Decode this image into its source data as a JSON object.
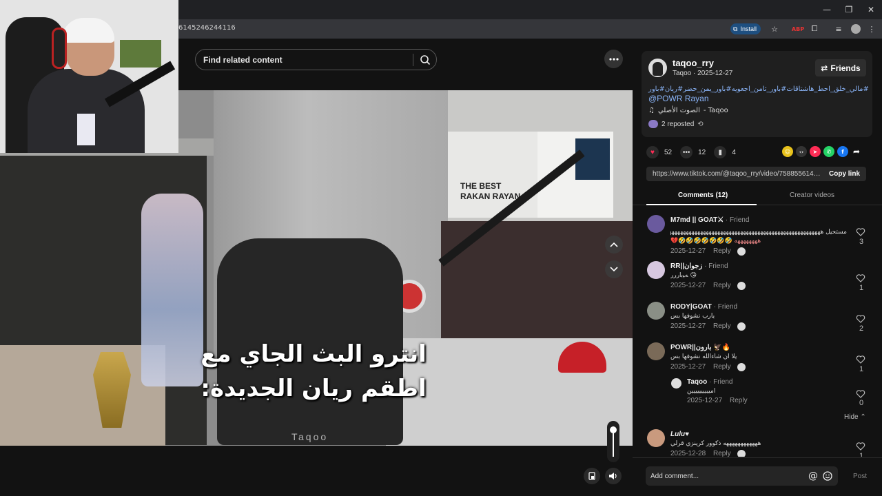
{
  "browser": {
    "url": "6145246244116",
    "install_label": "Install"
  },
  "video": {
    "search_placeholder": "Find related content",
    "caption_line1": "انترو البث الجاي مع",
    "caption_line2": "اطقم ريان الجديدة:",
    "watermark": "Taqoo",
    "poster_text": "THE BEST RAKAN RAYAN",
    "volume_level": 0.9
  },
  "post": {
    "username": "taqoo_rry",
    "meta": "Taqoo · 2025-12-27",
    "friends_label": "Friends",
    "hashtags": "#مالي_خلق_احط_هاشتاقات#باور_ثامن_اجعويه#باور_يمن_حضر#ريان#باور",
    "mention": "@POWR Rayan",
    "sound_name": "الصوت الأصلي",
    "sound_author": "- Taqoo",
    "reposted": "2 reposted",
    "likes": "52",
    "comments": "12",
    "saves": "4",
    "link": "https://www.tiktok.com/@taqoo_rry/video/7588556145...",
    "copy_link_label": "Copy link"
  },
  "tabs": {
    "comments_label": "Comments (12)",
    "creator_label": "Creator videos"
  },
  "comments": [
    {
      "name": "M7md || GOAT⚔",
      "friend": " · Friend",
      "text": "مستحيل ههههههههههههههههههههههههههههههههههههههههههههههههههههههههههه",
      "emoji": "💔🤣🤣🤣🤣🤣🤣🤣 ههههههههه",
      "date": "2025-12-27",
      "reply": "Reply",
      "likes": "3"
    },
    {
      "name": "RR||زجوان",
      "friend": " · Friend",
      "text": "ﻪﻴﺑاﺭﺭﺭ 😘",
      "date": "2025-12-27",
      "reply": "Reply",
      "likes": "1"
    },
    {
      "name": "RODY|GOAT",
      "friend": " · Friend",
      "text": "يارب نشوفها بس",
      "date": "2025-12-27",
      "reply": "Reply",
      "likes": "2"
    },
    {
      "name": "POWR||بارون 🦅🔥",
      "friend": "",
      "text": "يلا ان شاءالله نشوفها بس",
      "date": "2025-12-27",
      "reply": "Reply",
      "likes": "1"
    },
    {
      "name": "Taqoo",
      "friend": " · Friend",
      "text": "اميييييييييين",
      "date": "2025-12-27",
      "reply": "Reply",
      "likes": "0"
    },
    {
      "name": "Lulu♥",
      "friend": "",
      "text": "ههههههههههههه ذكوور كرينزي قرلي",
      "date": "2025-12-28",
      "reply": "Reply",
      "likes": "1"
    }
  ],
  "hide_label": "Hide",
  "comment_box": {
    "placeholder": "Add comment...",
    "post_label": "Post"
  },
  "colors": {
    "link_blue": "#8ab4f8",
    "like_pink": "#fe2c55",
    "install_bg": "#1e4f80"
  }
}
